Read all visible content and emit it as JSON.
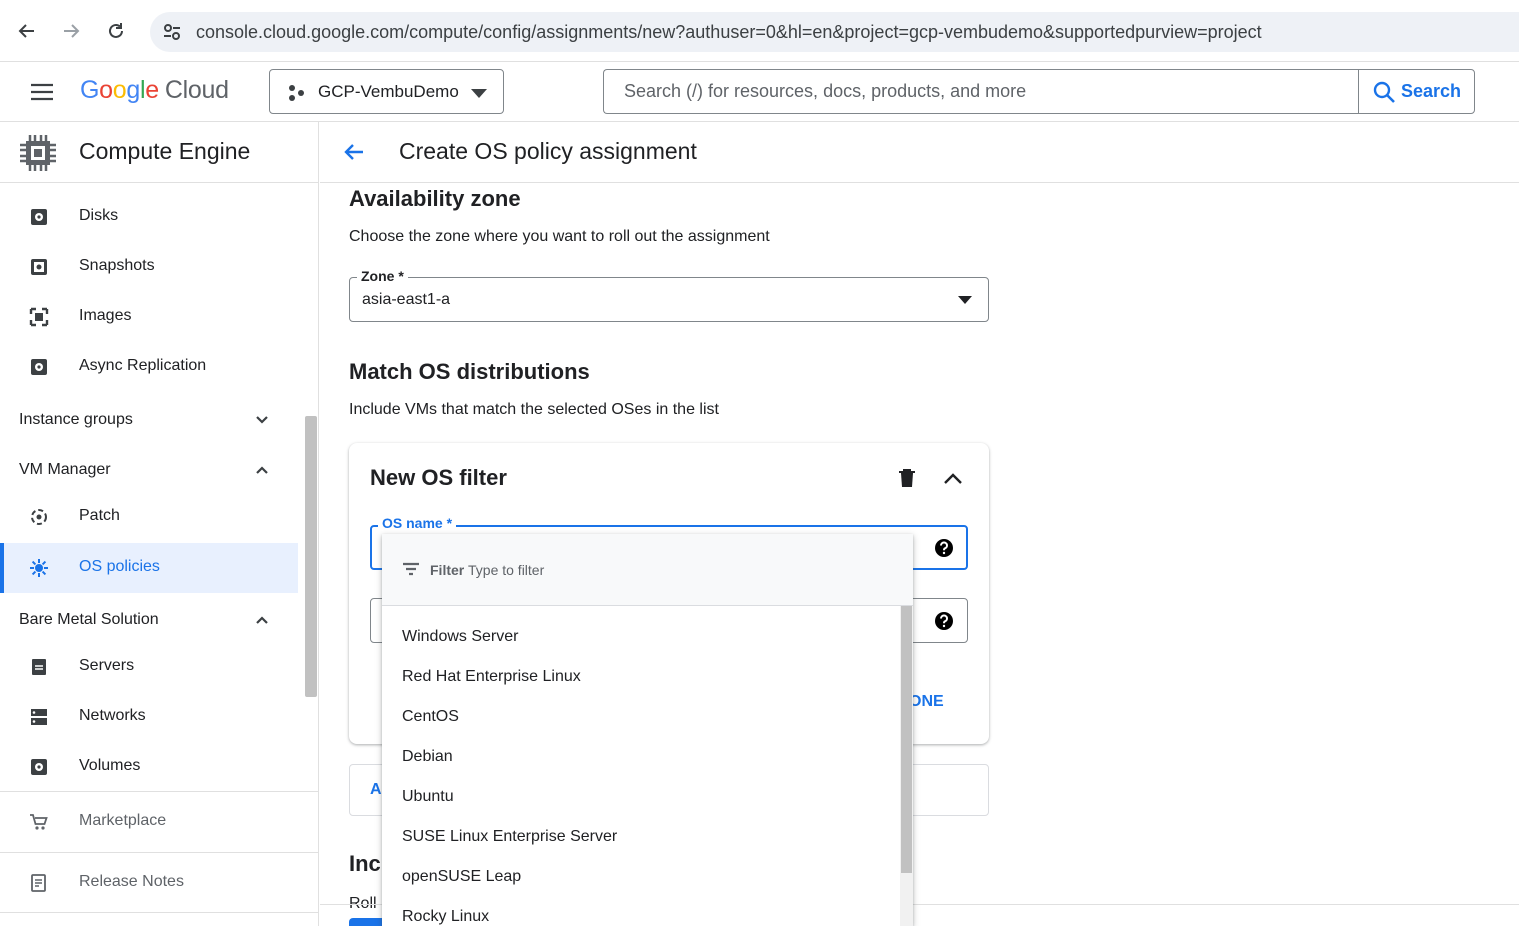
{
  "browser": {
    "url": "console.cloud.google.com/compute/config/assignments/new?authuser=0&hl=en&project=gcp-vembudemo&supportedpurview=project"
  },
  "header": {
    "logo_letters": [
      "G",
      "o",
      "o",
      "g",
      "l",
      "e"
    ],
    "logo_cloud": "Cloud",
    "project_name": "GCP-VembuDemo",
    "search_placeholder": "Search (/) for resources, docs, products, and more",
    "search_button": "Search"
  },
  "sidebar": {
    "title": "Compute Engine",
    "items": [
      {
        "label": "Disks",
        "icon": "disk-icon"
      },
      {
        "label": "Snapshots",
        "icon": "snapshot-icon"
      },
      {
        "label": "Images",
        "icon": "image-icon"
      },
      {
        "label": "Async Replication",
        "icon": "replication-icon"
      }
    ],
    "groups": {
      "instance_groups": "Instance groups",
      "vm_manager": "VM Manager",
      "bare_metal": "Bare Metal Solution"
    },
    "vm_manager_items": [
      {
        "label": "Patch",
        "icon": "patch-icon"
      },
      {
        "label": "OS policies",
        "icon": "os-policies-icon",
        "active": true
      }
    ],
    "bare_metal_items": [
      {
        "label": "Servers",
        "icon": "server-icon"
      },
      {
        "label": "Networks",
        "icon": "network-icon"
      },
      {
        "label": "Volumes",
        "icon": "volume-icon"
      }
    ],
    "marketplace": "Marketplace",
    "release_notes": "Release Notes"
  },
  "page": {
    "title": "Create OS policy assignment",
    "availability": {
      "title": "Availability zone",
      "desc": "Choose the zone where you want to roll out the assignment",
      "zone_label": "Zone *",
      "zone_value": "asia-east1-a"
    },
    "match_os": {
      "title": "Match OS distributions",
      "desc": "Include VMs that match the selected OSes in the list"
    },
    "filter_card": {
      "title": "New OS filter",
      "os_name_label": "OS name *",
      "done_partial": "ONE"
    },
    "add_partial": "A",
    "include_partial_title": "Incl",
    "include_partial_desc": "Roll"
  },
  "dropdown": {
    "filter_label": "Filter",
    "filter_placeholder": "Type to filter",
    "options": [
      "Windows Server",
      "Red Hat Enterprise Linux",
      "CentOS",
      "Debian",
      "Ubuntu",
      "SUSE Linux Enterprise Server",
      "openSUSE Leap",
      "Rocky Linux"
    ]
  },
  "colors": {
    "accent": "#1a73e8",
    "active_bg": "#e8f0fe",
    "text": "#202124",
    "muted": "#5f6368"
  }
}
